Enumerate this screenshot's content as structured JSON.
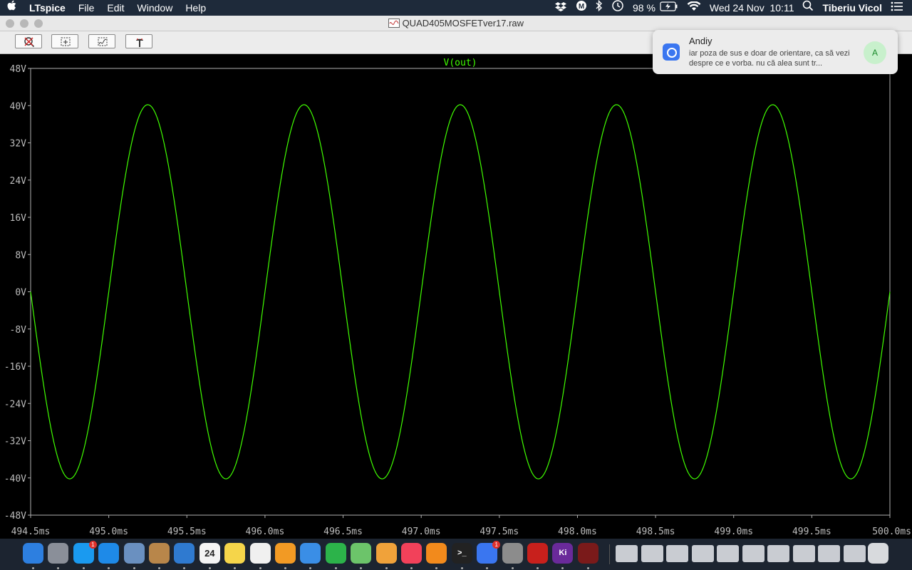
{
  "menubar": {
    "apple": "",
    "app_name": "LTspice",
    "menus": [
      "File",
      "Edit",
      "Window",
      "Help"
    ],
    "battery": "98 %",
    "datetime": "Wed 24 Nov  10:11",
    "user": "Tiberiu Vicol",
    "icons": [
      "dropbox-icon",
      "m-icon",
      "bluetooth-icon",
      "time-machine-icon",
      "battery-icon",
      "wifi-icon",
      "search-icon",
      "list-icon"
    ]
  },
  "window": {
    "title": "QUAD405MOSFETver17.raw",
    "toolbar": [
      {
        "name": "zoom-cancel-button",
        "icon": "zoom-cancel-icon"
      },
      {
        "name": "zoom-area-button",
        "icon": "zoom-area-icon"
      },
      {
        "name": "autorange-button",
        "icon": "autorange-icon"
      },
      {
        "name": "probe-button",
        "icon": "probe-icon"
      }
    ]
  },
  "notification": {
    "sender": "Andiy",
    "message": "iar poza de sus e doar de orientare, ca să vezi despre ce e vorba. nu că alea sunt tr...",
    "avatar_letter": "A",
    "app_icon": "signal-icon"
  },
  "chart_data": {
    "type": "line",
    "title": "V(out)",
    "xlabel": "",
    "ylabel": "",
    "x_unit": "ms",
    "y_unit": "V",
    "xlim": [
      494.5,
      500.0
    ],
    "ylim": [
      -48,
      48
    ],
    "x_ticks": [
      "494.5ms",
      "495.0ms",
      "495.5ms",
      "496.0ms",
      "496.5ms",
      "497.0ms",
      "497.5ms",
      "498.0ms",
      "498.5ms",
      "499.0ms",
      "499.5ms",
      "500.0ms"
    ],
    "y_ticks": [
      "48V",
      "40V",
      "32V",
      "24V",
      "16V",
      "8V",
      "0V",
      "-8V",
      "-16V",
      "-24V",
      "-32V",
      "-40V",
      "-48V"
    ],
    "series": [
      {
        "name": "V(out)",
        "color": "#40ff00",
        "shape": "sine",
        "amplitude_v": 40.2,
        "frequency_hz": 1000,
        "offset_v": 0,
        "x": [
          494.5,
          494.75,
          495.0,
          495.25,
          495.5,
          495.75,
          496.0,
          496.25,
          496.5,
          496.75,
          497.0,
          497.25,
          497.5,
          497.75,
          498.0,
          498.25,
          498.5,
          498.75,
          499.0,
          499.25,
          499.5,
          499.75,
          500.0
        ],
        "y": [
          0,
          -40.2,
          0,
          40.2,
          0,
          -40.2,
          0,
          40.2,
          0,
          -40.2,
          0,
          40.2,
          0,
          -40.2,
          0,
          40.2,
          0,
          -40.2,
          0,
          40.2,
          0,
          -40.2,
          0
        ]
      }
    ],
    "grid": false,
    "legend": "top-center"
  },
  "dock": {
    "apps": [
      {
        "name": "finder",
        "color": "#2d7fe0",
        "label": ""
      },
      {
        "name": "launchpad",
        "color": "#8a8f99",
        "label": ""
      },
      {
        "name": "app-store",
        "color": "#1a9af0",
        "label": "",
        "badge": "1"
      },
      {
        "name": "safari",
        "color": "#1e8ae8",
        "label": ""
      },
      {
        "name": "preview",
        "color": "#6a90c0",
        "label": ""
      },
      {
        "name": "archive",
        "color": "#b8864a",
        "label": ""
      },
      {
        "name": "xcode",
        "color": "#2f7ad0",
        "label": ""
      },
      {
        "name": "calendar",
        "color": "#f4f4f4",
        "label": "24"
      },
      {
        "name": "notes",
        "color": "#f5d54a",
        "label": ""
      },
      {
        "name": "textedit",
        "color": "#f0f0f0",
        "label": ""
      },
      {
        "name": "pages",
        "color": "#f29a24",
        "label": ""
      },
      {
        "name": "keynote",
        "color": "#3a8ee6",
        "label": ""
      },
      {
        "name": "numbers",
        "color": "#2cb34a",
        "label": ""
      },
      {
        "name": "maps",
        "color": "#6cc46a",
        "label": ""
      },
      {
        "name": "photos",
        "color": "#f0a23a",
        "label": ""
      },
      {
        "name": "music",
        "color": "#f2415a",
        "label": ""
      },
      {
        "name": "books",
        "color": "#f28a1c",
        "label": ""
      },
      {
        "name": "terminal",
        "color": "#222222",
        "label": ">_"
      },
      {
        "name": "signal",
        "color": "#3a76f0",
        "label": "",
        "badge": "1"
      },
      {
        "name": "calculator",
        "color": "#8c8c8c",
        "label": ""
      },
      {
        "name": "acrobat",
        "color": "#c8201c",
        "label": ""
      },
      {
        "name": "kicad",
        "color": "#6a2a9a",
        "label": "Ki"
      },
      {
        "name": "ltspice",
        "color": "#7a1a1a",
        "label": ""
      }
    ],
    "windows": 10
  }
}
